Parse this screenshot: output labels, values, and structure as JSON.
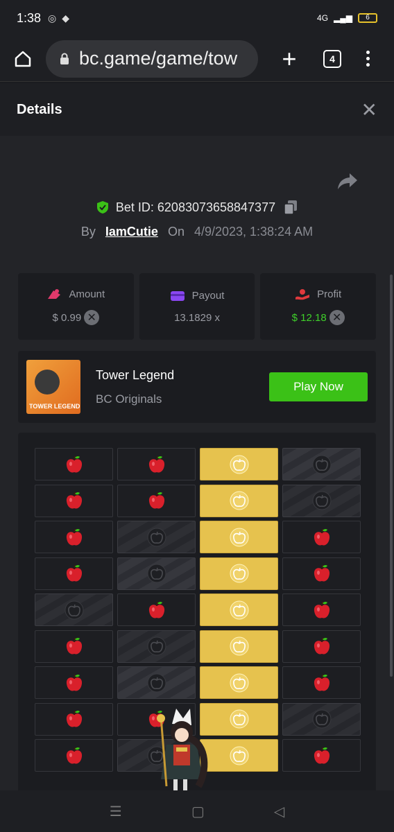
{
  "status": {
    "time": "1:38",
    "network": "4G",
    "battery": "6"
  },
  "browser": {
    "url": "bc.game/game/tow",
    "tab_count": "4"
  },
  "details": {
    "title": "Details",
    "bet_id_label": "Bet ID: 62083073658847377",
    "by_label": "By",
    "user": "IamCutie",
    "on_label": "On",
    "date": "4/9/2023, 1:38:24 AM"
  },
  "stats": {
    "amount_label": "Amount",
    "amount_value": "$ 0.99",
    "payout_label": "Payout",
    "payout_value": "13.1829 x",
    "profit_label": "Profit",
    "profit_value": "$ 12.18"
  },
  "game": {
    "name": "Tower Legend",
    "provider": "BC Originals",
    "thumb_text": "TOWER LEGEND",
    "play_label": "Play Now"
  },
  "board": {
    "rows": [
      [
        "apple",
        "apple",
        "gold",
        "bomb"
      ],
      [
        "apple",
        "apple",
        "gold",
        "bomb-dim"
      ],
      [
        "apple",
        "bomb-dim",
        "gold",
        "apple"
      ],
      [
        "apple",
        "bomb",
        "gold",
        "apple"
      ],
      [
        "bomb-dim",
        "apple",
        "gold",
        "apple"
      ],
      [
        "apple",
        "bomb-dim",
        "gold",
        "apple"
      ],
      [
        "apple",
        "bomb",
        "gold",
        "apple"
      ],
      [
        "apple",
        "apple",
        "gold",
        "bomb-dim"
      ],
      [
        "apple",
        "bomb-dim",
        "gold",
        "apple"
      ]
    ]
  },
  "colors": {
    "accent_green": "#3bc117",
    "profit_green": "#3fcf2a",
    "gold": "#e6c24e",
    "apple_red": "#d9202b"
  }
}
